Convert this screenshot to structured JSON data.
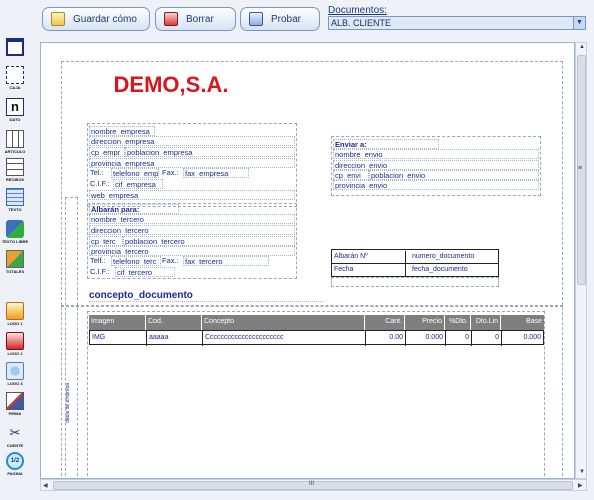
{
  "toolbar": {
    "save_label": "Guardar cómo",
    "delete_label": "Borrar",
    "test_label": "Probar"
  },
  "documents": {
    "label": "Documentos:",
    "selected": "ALB. CLIENTE"
  },
  "tools": [
    {
      "label": ""
    },
    {
      "label": "CAJA"
    },
    {
      "label": "DATO"
    },
    {
      "label": "ARTICULO"
    },
    {
      "label": "RECIBOS"
    },
    {
      "label": "TEXTO"
    },
    {
      "label": "TEXTO LIBRE"
    },
    {
      "label": "TOTALES"
    },
    {
      "label": "LOGO 1"
    },
    {
      "label": "LOGO 2"
    },
    {
      "label": "LOGO 3"
    },
    {
      "label": "FIRMA"
    },
    {
      "label": "CUENTE"
    },
    {
      "label": "PAGINA"
    }
  ],
  "canvas": {
    "logo_text": "DEMO,S.A.",
    "company": {
      "nombre": "nombre_empresa",
      "direccion": "direccion_empresa",
      "cp": "cp_empr",
      "poblacion": "poblacion_empresa",
      "provincia": "provincia_empresa",
      "tel_label": "Tel.:",
      "telefono": "telefono_emp",
      "fax_label": "Fax.:",
      "fax": "fax_empresa",
      "cif_label": "C.I.F.:",
      "cif": "cif_empresa",
      "web": "web_empresa"
    },
    "albaran_para": {
      "title": "Albarán para:",
      "nombre": "nombre_tercero",
      "direccion": "direccion_tercero",
      "cp": "cp_terc",
      "poblacion": "poblacion_tercero",
      "provincia": "provincia_tercero",
      "tel_label": "Telf.:",
      "telefono": "telefono_terc",
      "fax_label": "Fax.:",
      "fax": "fax_tercero",
      "cif_label": "C.I.F.:",
      "cif": "cif_tercero"
    },
    "enviar_a": {
      "title": "Enviar a:",
      "nombre": "nombre_envio",
      "direccion": "direccion_envio",
      "cp": "cp_envi",
      "poblacion": "poblacion_envio",
      "provincia": "provincia_envio"
    },
    "albaran_info": {
      "num_label": "Albarán Nº",
      "num_value": "numero_documento",
      "fecha_label": "Fecha",
      "fecha_value": "fecha_documento"
    },
    "concepto": "concepto_documento",
    "side_text": "datos de empresa",
    "table": {
      "headers": [
        "Imagen",
        "Cod.",
        "Concepto",
        "Cant.",
        "Precio",
        "%Dto.",
        "Dto.Lin",
        "Base"
      ],
      "row": [
        "IMG",
        "aaaaa",
        "Cccccccccccccccccccccc",
        "0.00",
        "0.000",
        "0",
        "0",
        "0.000"
      ]
    }
  },
  "scroll": {
    "hmark": "III",
    "vmark": "≡"
  }
}
